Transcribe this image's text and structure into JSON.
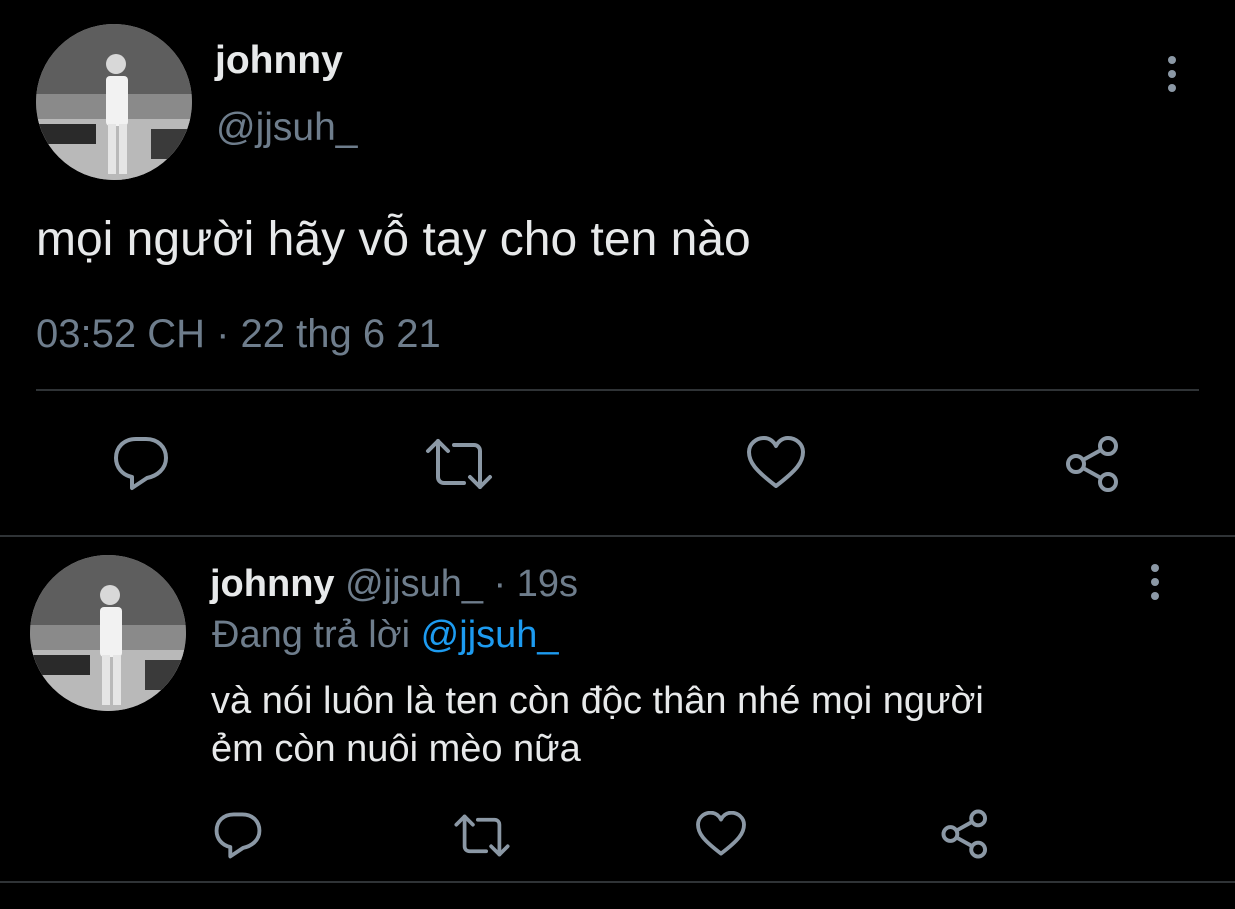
{
  "main_tweet": {
    "display_name": "johnny",
    "handle": "@jjsuh_",
    "text": "mọi người hãy vỗ tay cho ten nào",
    "timestamp": "03:52 CH · 22 thg 6 21",
    "icons": [
      "comment-icon",
      "retweet-icon",
      "like-icon",
      "share-icon",
      "more-options-icon"
    ]
  },
  "reply_tweet": {
    "display_name": "johnny",
    "handle": "@jjsuh_",
    "separator_time": "· 19s",
    "replying_prefix": "Đang trả lời",
    "replying_to": "@jjsuh_",
    "text_line1": "và nói luôn là ten còn độc thân nhé mọi người",
    "text_line2": "ẻm còn nuôi mèo nữa",
    "icons": [
      "comment-icon",
      "retweet-icon",
      "like-icon",
      "share-icon",
      "more-options-icon"
    ]
  },
  "colors": {
    "background": "#000000",
    "text": "#e7e9ea",
    "muted": "#6e7d8c",
    "link": "#1d9bf0",
    "divider": "#2f3336"
  }
}
